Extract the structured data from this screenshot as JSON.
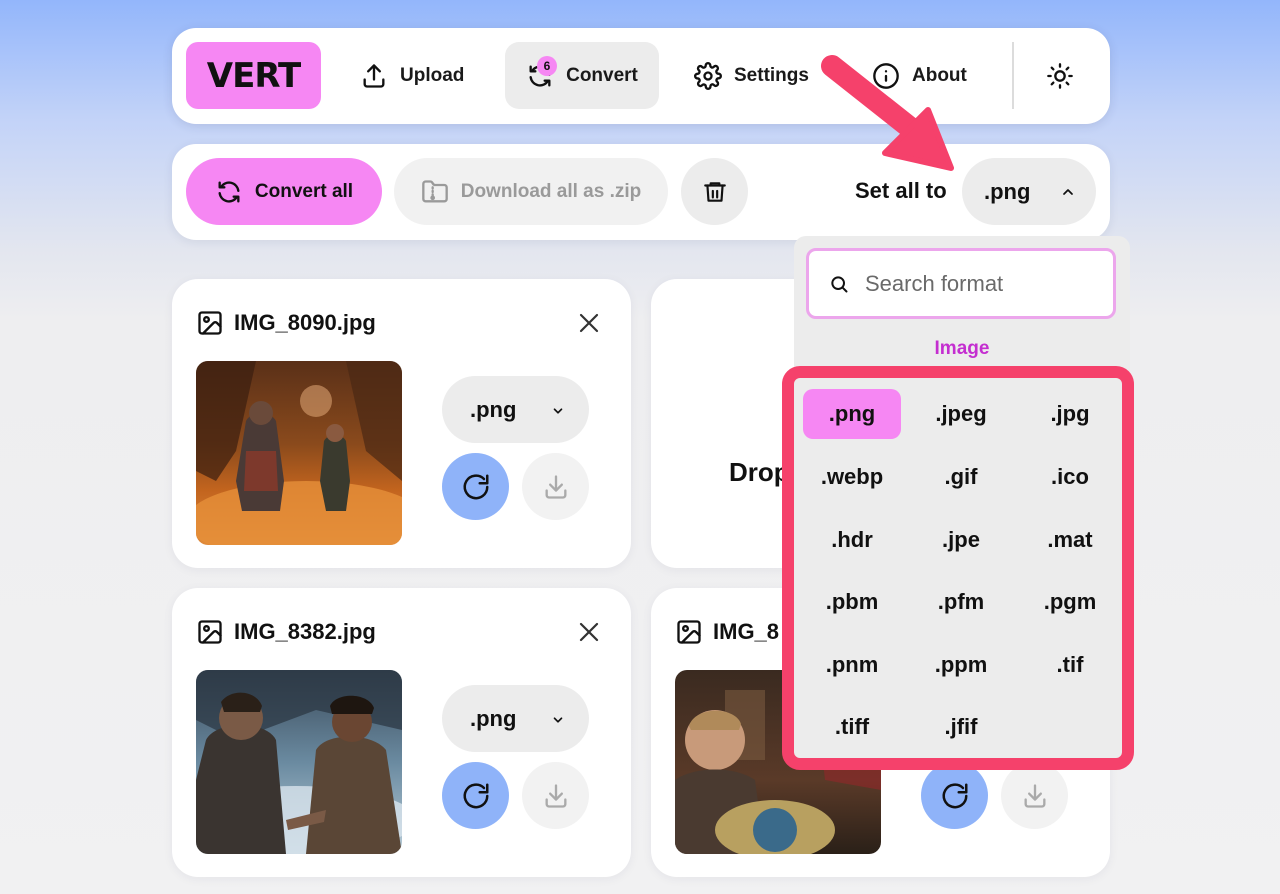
{
  "nav": {
    "logo": "VERT",
    "upload_label": "Upload",
    "convert_label": "Convert",
    "convert_badge": "6",
    "settings_label": "Settings",
    "about_label": "About"
  },
  "actions": {
    "convert_all_label": "Convert all",
    "download_zip_label": "Download all as .zip",
    "set_all_label": "Set all to",
    "set_all_value": ".png"
  },
  "files": [
    {
      "name": "IMG_8090.jpg",
      "format": ".png"
    },
    {
      "name": "IMG_8382.jpg",
      "format": ".png"
    },
    {
      "name": "IMG_8"
    }
  ],
  "dropzone": {
    "text": "Drop"
  },
  "dropdown": {
    "search_placeholder": "Search format",
    "category": "Image",
    "formats": [
      ".png",
      ".jpeg",
      ".jpg",
      ".webp",
      ".gif",
      ".ico",
      ".hdr",
      ".jpe",
      ".mat",
      ".pbm",
      ".pfm",
      ".pgm",
      ".pnm",
      ".ppm",
      ".tif",
      ".tiff",
      ".jfif"
    ],
    "selected": ".png"
  },
  "colors": {
    "accent_pink": "#f687f3",
    "accent_blue": "#8fb3f9",
    "highlight_red": "#f5416b",
    "category_purple": "#c42ed0"
  }
}
